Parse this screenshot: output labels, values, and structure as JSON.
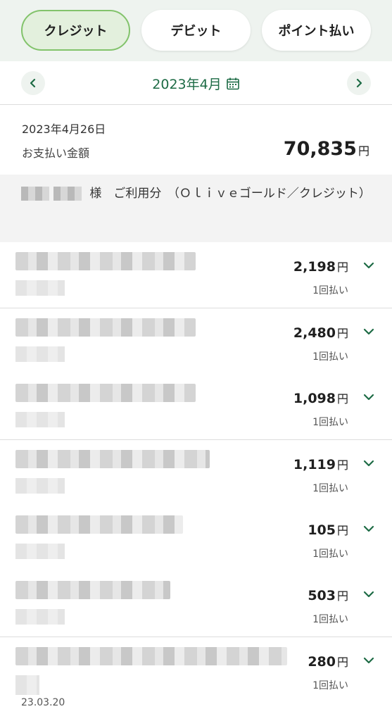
{
  "tabs": [
    {
      "label": "クレジット",
      "active": true
    },
    {
      "label": "デビット",
      "active": false
    },
    {
      "label": "ポイント払い",
      "active": false
    }
  ],
  "month_nav": {
    "month": "2023年4月",
    "prev_icon": "chevron-left-icon",
    "next_icon": "chevron-right-icon",
    "calendar_icon": "calendar-icon"
  },
  "summary": {
    "date": "2023年4月26日",
    "label": "お支払い金額",
    "amount": "70,835",
    "unit": "円"
  },
  "section": {
    "suffix": "様　ご利用分　（Ｏｌｉｖｅゴールド／クレジット）"
  },
  "transactions": [
    {
      "amount": "2,198",
      "unit": "円",
      "plan": "1回払い"
    },
    {
      "amount": "2,480",
      "unit": "円",
      "plan": "1回払い"
    },
    {
      "amount": "1,098",
      "unit": "円",
      "plan": "1回払い"
    },
    {
      "amount": "1,119",
      "unit": "円",
      "plan": "1回払い"
    },
    {
      "amount": "105",
      "unit": "円",
      "plan": "1回払い"
    },
    {
      "amount": "503",
      "unit": "円",
      "plan": "1回払い"
    },
    {
      "amount": "280",
      "unit": "円",
      "plan": "1回払い"
    }
  ],
  "footer_date": "23.03.20",
  "colors": {
    "accent": "#1d6b45",
    "active_tab_bg": "#e3f0dd",
    "active_tab_border": "#82c36b"
  }
}
